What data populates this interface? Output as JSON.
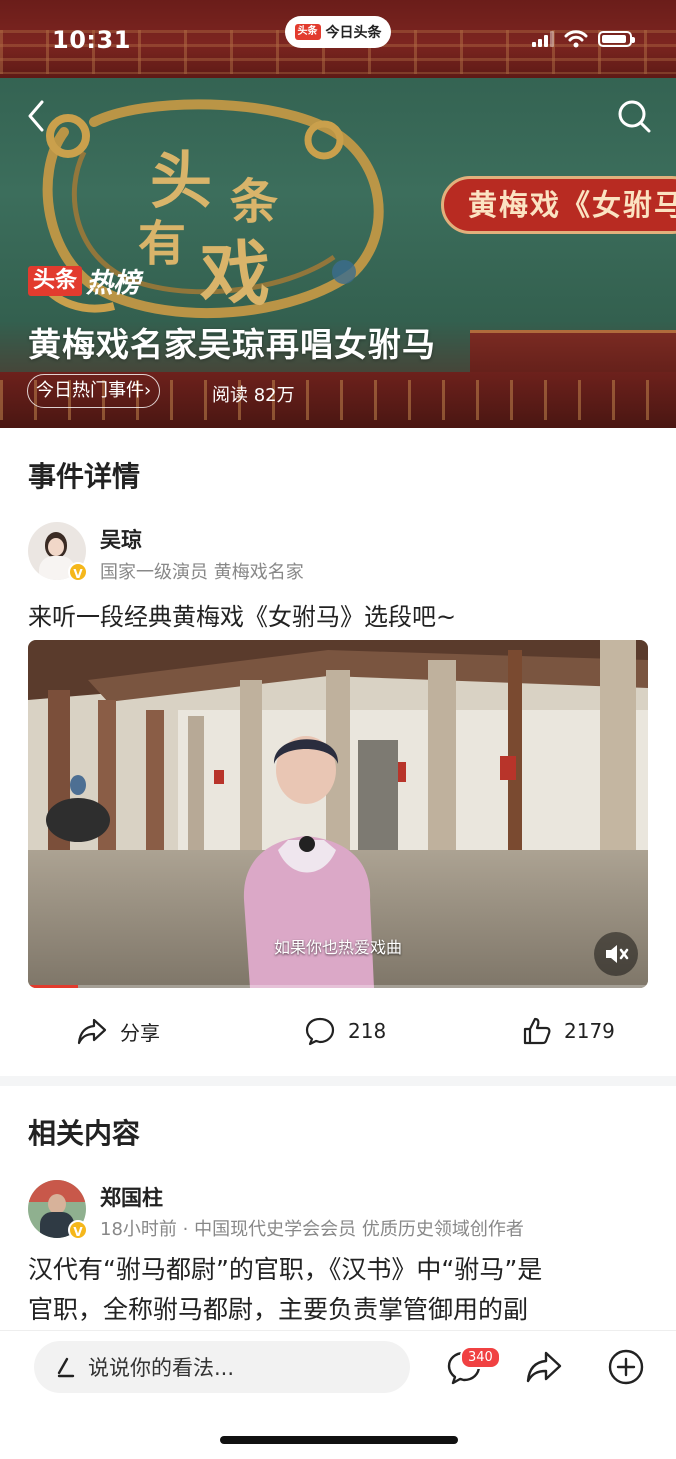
{
  "status_bar": {
    "time": "10:31",
    "app_pill_logo": "头条",
    "app_pill_label": "今日头条"
  },
  "hero": {
    "calligraphy": "头条有戏",
    "tag": "黄梅戏《女驸马",
    "badge_logo": "头条",
    "badge_text": "热榜",
    "title": "黄梅戏名家吴琼再唱女驸马",
    "event_chip": "今日热门事件",
    "read_count": "阅读 82万"
  },
  "event_details": {
    "section_title": "事件详情",
    "author": {
      "name": "吴琼",
      "description": "国家一级演员 黄梅戏名家",
      "verified": true
    },
    "post_text": "来听一段经典黄梅戏《女驸马》选段吧~",
    "video": {
      "caption": "如果你也热爱戏曲",
      "muted": true,
      "progress": 0.08
    },
    "actions": {
      "share_label": "分享",
      "comment_count": "218",
      "like_count": "2179"
    }
  },
  "related": {
    "section_title": "相关内容",
    "author": {
      "name": "郑国柱",
      "time": "18小时前",
      "description": "中国现代史学会会员 优质历史领域创作者",
      "verified": true
    },
    "text_line1": "汉代有“驸马都尉”的官职，《汉书》中“驸马”是",
    "text_line2": "官职，全称驸马都尉，主要负责掌管御用的副"
  },
  "bottom_bar": {
    "comment_placeholder": "说说你的看法...",
    "comment_badge": "340"
  },
  "colors": {
    "brand_red": "#e23b2e",
    "verify_gold": "#f5b71b",
    "badge_red": "#f04142"
  }
}
